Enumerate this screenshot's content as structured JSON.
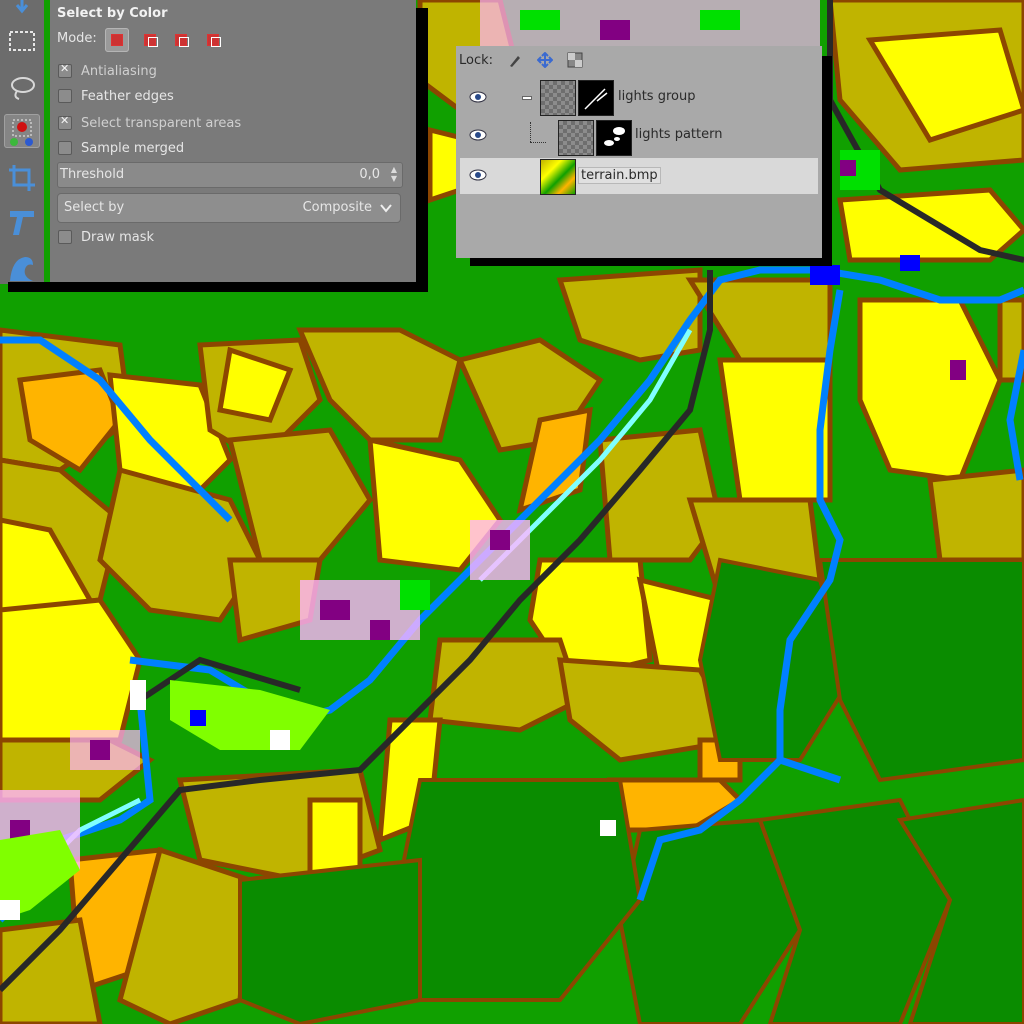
{
  "tool_options": {
    "title": "Select by Color",
    "mode_label": "Mode:",
    "antialiasing": {
      "label": "Antialiasing",
      "checked": true
    },
    "feather_edges": {
      "label": "Feather edges",
      "checked": false
    },
    "select_transparent": {
      "label": "Select transparent areas",
      "checked": true
    },
    "sample_merged": {
      "label": "Sample merged",
      "checked": false
    },
    "threshold": {
      "label": "Threshold",
      "value": "0,0"
    },
    "select_by": {
      "label": "Select by",
      "value": "Composite"
    },
    "draw_mask": {
      "label": "Draw mask",
      "checked": false
    }
  },
  "layers": {
    "lock_label": "Lock:",
    "items": [
      {
        "name": "lights group",
        "visible": true
      },
      {
        "name": "lights pattern",
        "visible": true
      },
      {
        "name": "terrain.bmp",
        "visible": true,
        "selected": true
      }
    ]
  },
  "colors": {
    "grass": "#0fa000",
    "field_olive": "#c0b400",
    "field_yellow": "#ffff00",
    "field_orange": "#ffb400",
    "border_brown": "#8c4600",
    "river_blue": "#0080ff",
    "road_dark": "#282828"
  }
}
